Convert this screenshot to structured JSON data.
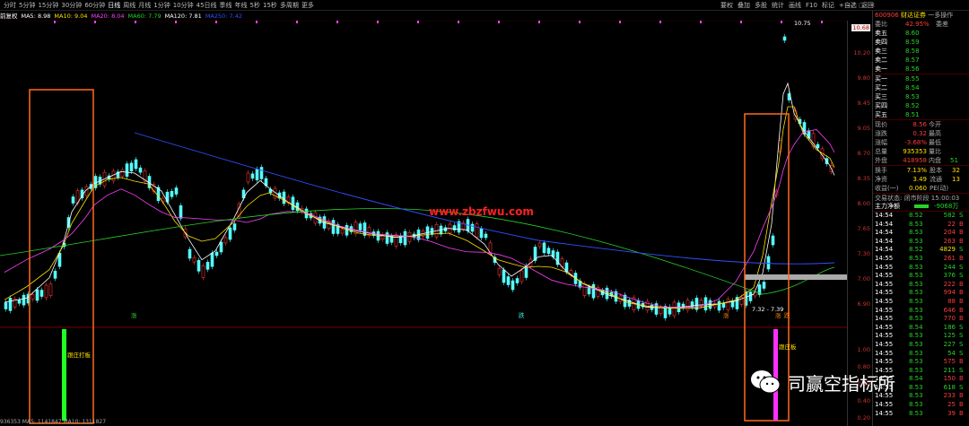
{
  "tabs": [
    "分时",
    "5分钟",
    "15分钟",
    "30分钟",
    "60分钟",
    "日线",
    "周线",
    "月线",
    "1分钟",
    "10分钟",
    "45日线",
    "季线",
    "年线",
    "5秒",
    "15秒",
    "多周期",
    "更多"
  ],
  "active_tab_index": 5,
  "toolbar": [
    "要权",
    "叠加",
    "多股",
    "统计",
    "画线",
    "F10",
    "标记",
    "+自选",
    "返回"
  ],
  "window_controls": [
    "—",
    "□",
    "✕"
  ],
  "stock": {
    "code": "600906",
    "name": "财达证券",
    "menu": "一多操作"
  },
  "chart_title": "前复权",
  "ma_legend": [
    {
      "label": "MA5: 8.98",
      "color": "#ffffff"
    },
    {
      "label": "MA10: 9.04",
      "color": "#ffe000"
    },
    {
      "label": "MA20: 8.04",
      "color": "#ff40ff"
    },
    {
      "label": "MA60: 7.79",
      "color": "#28d228"
    },
    {
      "label": "MA120: 7.81",
      "color": "#ffffff"
    },
    {
      "label": "MA250: 7.42",
      "color": "#3050ff"
    }
  ],
  "price_ticks": [
    "10.68",
    "10.20",
    "9.80",
    "9.45",
    "9.05",
    "8.70",
    "8.35",
    "8.00",
    "7.65",
    "7.30",
    "7.00",
    "6.90"
  ],
  "indicator_ticks": [
    "1.00",
    "0.80",
    "0.60",
    "0.40",
    "0.20",
    "0.00"
  ],
  "annotations": {
    "high_label": "10.75",
    "range_label": "7.32 - 7.39",
    "signal_left": "跟庄打板",
    "signal_right": "跟庄板",
    "markers": [
      "涨",
      "跌",
      "涨",
      "涨",
      "跌"
    ]
  },
  "orderbook": {
    "ratio_label": "委比",
    "ratio_value": "42.95%",
    "diff_label": "委差",
    "asks": [
      {
        "label": "卖五",
        "price": "8.60"
      },
      {
        "label": "卖四",
        "price": "8.59"
      },
      {
        "label": "卖三",
        "price": "8.58"
      },
      {
        "label": "卖二",
        "price": "8.57"
      },
      {
        "label": "卖一",
        "price": "8.56"
      }
    ],
    "bids": [
      {
        "label": "买一",
        "price": "8.55"
      },
      {
        "label": "买二",
        "price": "8.54"
      },
      {
        "label": "买三",
        "price": "8.53"
      },
      {
        "label": "买四",
        "price": "8.52"
      },
      {
        "label": "买五",
        "price": "8.51"
      }
    ]
  },
  "quote": {
    "rows": [
      {
        "l1": "现价",
        "v1": "8.56",
        "l2": "今开",
        "c": "red"
      },
      {
        "l1": "涨跌",
        "v1": "0.32",
        "l2": "最高",
        "c": "red"
      },
      {
        "l1": "涨幅",
        "v1": "-3.68%",
        "l2": "最低",
        "c": "red"
      },
      {
        "l1": "总量",
        "v1": "935353",
        "l2": "量比",
        "c": "yellow"
      },
      {
        "l1": "外盘",
        "v1": "418958",
        "l2": "内盘",
        "c": "red"
      }
    ],
    "inner_value": "51",
    "rows2": [
      {
        "l1": "换手",
        "v1": "7.13%",
        "l2": "股本",
        "v2": "32"
      },
      {
        "l1": "净资",
        "v1": "3.49",
        "l2": "流通",
        "v2": "13"
      },
      {
        "l1": "收益(一)",
        "v1": "0.060",
        "l2": "PE(动)",
        "v2": ""
      }
    ],
    "status": "交易状态: 闭市阶段 15:00:03",
    "main_flow_label": "主力净额",
    "main_flow_value": "-9068万"
  },
  "ticks": [
    {
      "t": "14:54",
      "p": "8.52",
      "v": "582",
      "s": "S"
    },
    {
      "t": "14:54",
      "p": "8.53",
      "v": "22",
      "s": "B"
    },
    {
      "t": "14:54",
      "p": "8.53",
      "v": "204",
      "s": "B"
    },
    {
      "t": "14:54",
      "p": "8.53",
      "v": "263",
      "s": "B"
    },
    {
      "t": "14:54",
      "p": "8.52",
      "v": "4829",
      "s": "S"
    },
    {
      "t": "14:55",
      "p": "8.53",
      "v": "261",
      "s": "B"
    },
    {
      "t": "14:55",
      "p": "8.53",
      "v": "244",
      "s": "S"
    },
    {
      "t": "14:55",
      "p": "8.53",
      "v": "376",
      "s": "S"
    },
    {
      "t": "14:55",
      "p": "8.53",
      "v": "222",
      "s": "B"
    },
    {
      "t": "14:55",
      "p": "8.53",
      "v": "994",
      "s": "B"
    },
    {
      "t": "14:55",
      "p": "8.53",
      "v": "88",
      "s": "B"
    },
    {
      "t": "14:55",
      "p": "8.53",
      "v": "646",
      "s": "B"
    },
    {
      "t": "14:55",
      "p": "8.53",
      "v": "770",
      "s": "B"
    },
    {
      "t": "14:55",
      "p": "8.54",
      "v": "186",
      "s": "S"
    },
    {
      "t": "14:55",
      "p": "8.53",
      "v": "125",
      "s": "S"
    },
    {
      "t": "14:55",
      "p": "8.53",
      "v": "227",
      "s": "S"
    },
    {
      "t": "14:55",
      "p": "8.53",
      "v": "54",
      "s": "S"
    },
    {
      "t": "14:55",
      "p": "8.53",
      "v": "575",
      "s": "B"
    },
    {
      "t": "14:55",
      "p": "8.53",
      "v": "211",
      "s": "S"
    },
    {
      "t": "14:55",
      "p": "8.54",
      "v": "150",
      "s": "B"
    },
    {
      "t": "14:55",
      "p": "8.53",
      "v": "618",
      "s": "S"
    },
    {
      "t": "14:55",
      "p": "8.53",
      "v": "233",
      "s": "B"
    },
    {
      "t": "14:55",
      "p": "8.53",
      "v": "25",
      "s": "B"
    },
    {
      "t": "14:55",
      "p": "8.53",
      "v": "39",
      "s": "B"
    }
  ],
  "watermark_url": "www.zbzfwu.com",
  "watermark_badge": "司赢空指标所",
  "bottom_status": "936353  MA5: 1141847  MA10: 1311827"
}
